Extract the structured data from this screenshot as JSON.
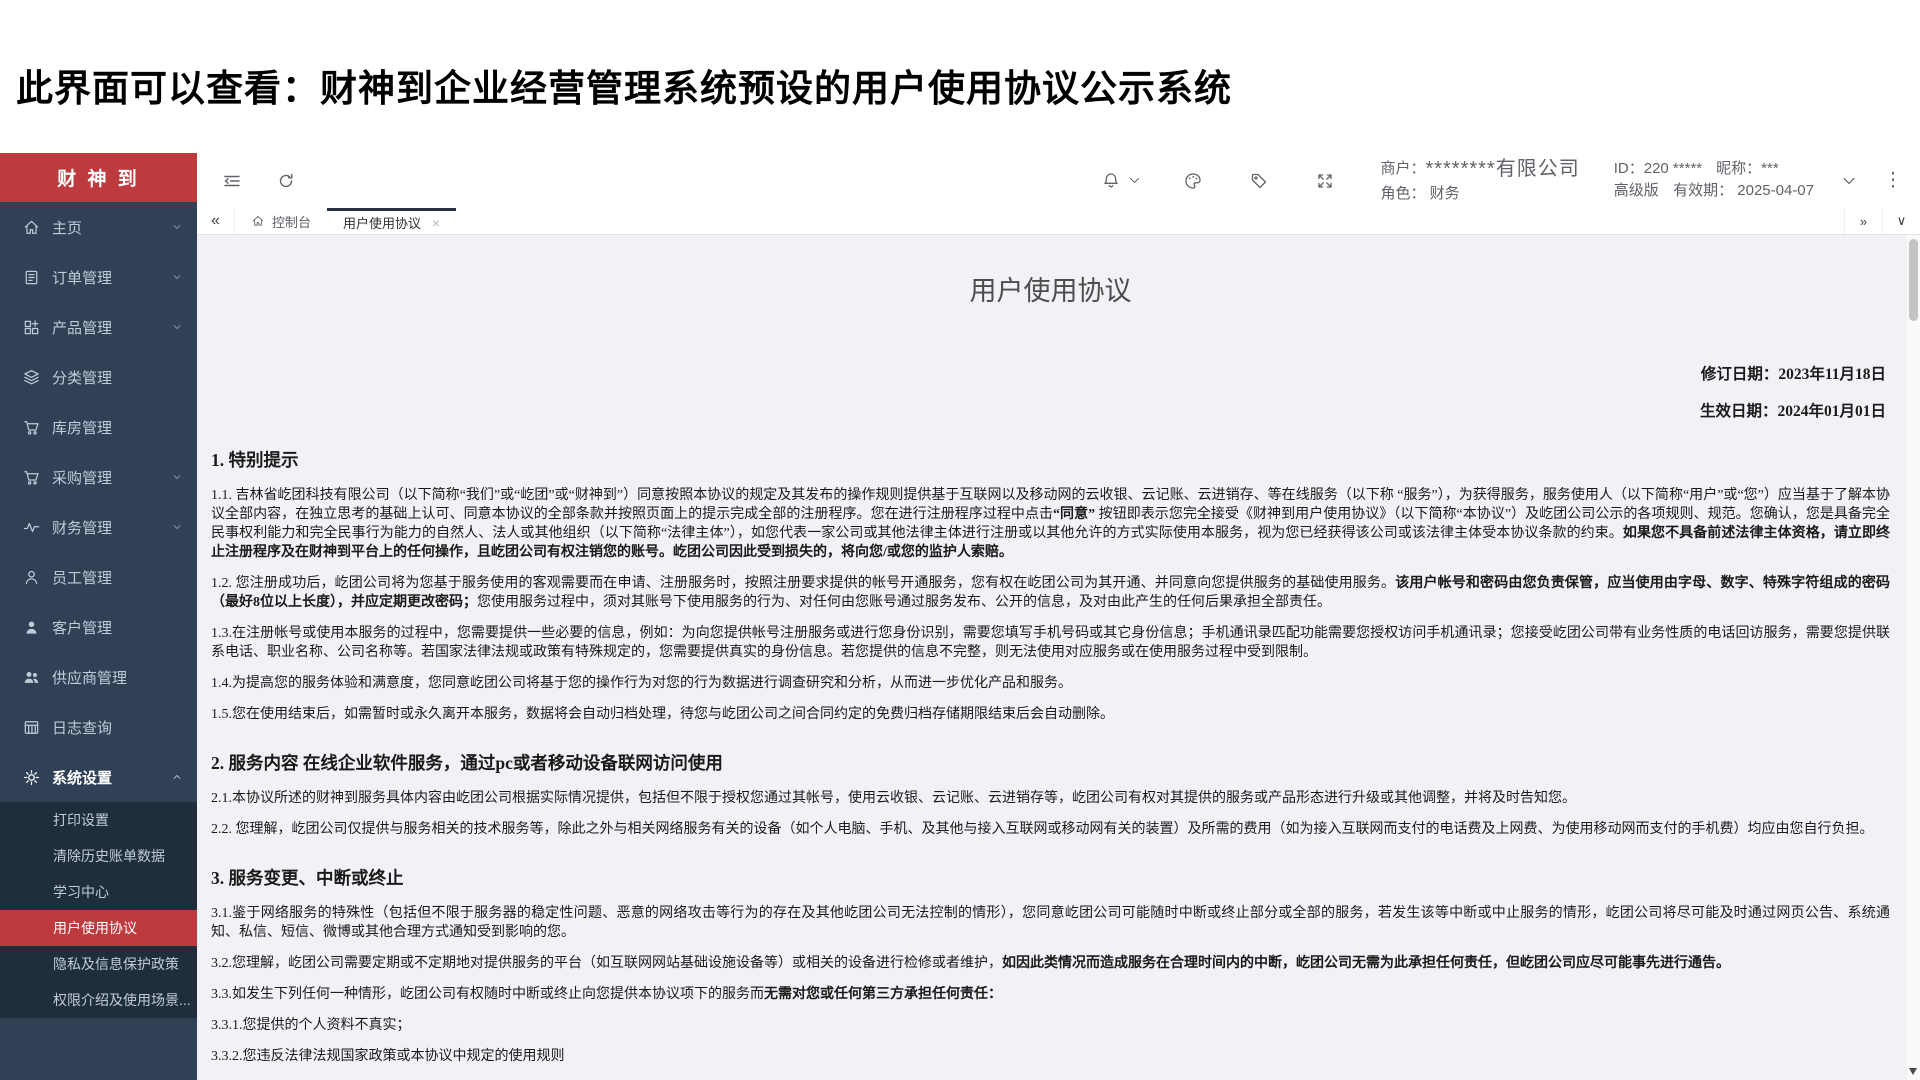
{
  "page": {
    "caption": "此界面可以查看：财神到企业经营管理系统预设的用户使用协议公示系统"
  },
  "sidebar": {
    "brand": "财 神 到",
    "items": [
      {
        "label": "主页",
        "icon": "home-icon",
        "chevron": "down"
      },
      {
        "label": "订单管理",
        "icon": "order-icon",
        "chevron": "down"
      },
      {
        "label": "产品管理",
        "icon": "product-icon",
        "chevron": "down"
      },
      {
        "label": "分类管理",
        "icon": "category-icon",
        "chevron": "none"
      },
      {
        "label": "库房管理",
        "icon": "warehouse-cart-icon",
        "chevron": "none"
      },
      {
        "label": "采购管理",
        "icon": "purchase-cart-icon",
        "chevron": "down"
      },
      {
        "label": "财务管理",
        "icon": "finance-icon",
        "chevron": "down"
      },
      {
        "label": "员工管理",
        "icon": "employee-icon",
        "chevron": "none"
      },
      {
        "label": "客户管理",
        "icon": "customer-icon",
        "chevron": "none"
      },
      {
        "label": "供应商管理",
        "icon": "supplier-icon",
        "chevron": "none"
      },
      {
        "label": "日志查询",
        "icon": "log-icon",
        "chevron": "none"
      },
      {
        "label": "系统设置",
        "icon": "settings-gear-icon",
        "chevron": "up",
        "active": true
      }
    ],
    "submenu": [
      {
        "label": "打印设置",
        "active": false
      },
      {
        "label": "清除历史账单数据",
        "active": false
      },
      {
        "label": "学习中心",
        "active": false
      },
      {
        "label": "用户使用协议",
        "active": true
      },
      {
        "label": "隐私及信息保护政策",
        "active": false
      },
      {
        "label": "权限介绍及使用场景...",
        "active": false
      }
    ]
  },
  "topbar": {
    "merchant_label": "商户：",
    "merchant_value": "********有限公司",
    "role_label": "角色：",
    "role_value": "财务",
    "id_label": "ID：",
    "id_value": "220 *****",
    "nick_label": "昵称：",
    "nick_value": "***",
    "edition": "高级版",
    "validity_label": "有效期：",
    "validity_value": "2025-04-07",
    "more_glyph": "⋮"
  },
  "tabbar": {
    "collapse_left": "«",
    "collapse_right": "»",
    "dropdown": "∨",
    "close_glyph": "×",
    "tabs": [
      {
        "label": "控制台",
        "icon": "home",
        "active": false,
        "closable": false
      },
      {
        "label": "用户使用协议",
        "icon": "",
        "active": true,
        "closable": true
      }
    ]
  },
  "document": {
    "title": "用户使用协议",
    "revision_date": "修订日期：2023年11月18日",
    "effective_date": "生效日期：2024年01月01日",
    "sections": [
      {
        "heading": "1. 特别提示",
        "paragraphs": [
          {
            "runs": [
              {
                "t": "1.1.  吉林省屹团科技有限公司（以下简称“我们”或“屹团”或“财神到”）同意按照本协议的规定及其发布的操作规则提供基于互联网以及移动网的云收银、云记账、云进销存、等在线服务（以下称 “服务”），为获得服务，服务使用人（以下简称“用户”或“您”）应当基于了解本协议全部内容，在独立思考的基础上认可、同意本协议的全部条款并按照页面上的提示完成全部的注册程序。您在进行注册程序过程中点击",
                "b": false
              },
              {
                "t": "“同意” ",
                "b": true
              },
              {
                "t": "按钮即表示您完全接受《财神到用户使用协议》（以下简称“本协议”）及屹团公司公示的各项规则、规范。您确认，您是具备完全民事权利能力和完全民事行为能力的自然人、法人或其他组织（以下简称“法律主体”），如您代表一家公司或其他法律主体进行注册或以其他允许的方式实际使用本服务，视为您已经获得该公司或该法律主体受本协议条款的约束。",
                "b": false
              },
              {
                "t": "如果您不具备前述法律主体资格，请立即终止注册程序及在财神到平台上的任何操作，且屹团公司有权注销您的账号。屹团公司因此受到损失的，将向您/或您的监护人索赔。",
                "b": true
              }
            ]
          },
          {
            "runs": [
              {
                "t": "1.2.  您注册成功后，屹团公司将为您基于服务使用的客观需要而在申请、注册服务时，按照注册要求提供的帐号开通服务，您有权在屹团公司为其开通、并同意向您提供服务的基础使用服务。",
                "b": false
              },
              {
                "t": "该用户帐号和密码由您负责保管，应当使用由字母、数字、特殊字符组成的密码（最好8位以上长度），并应定期更改密码；",
                "b": true
              },
              {
                "t": "您使用服务过程中，须对其账号下使用服务的行为、对任何由您账号通过服务发布、公开的信息，及对由此产生的任何后果承担全部责任。",
                "b": false
              }
            ]
          },
          {
            "runs": [
              {
                "t": "1.3.在注册帐号或使用本服务的过程中，您需要提供一些必要的信息，例如：为向您提供帐号注册服务或进行您身份识别，需要您填写手机号码或其它身份信息；手机通讯录匹配功能需要您授权访问手机通讯录；您接受屹团公司带有业务性质的电话回访服务，需要您提供联系电话、职业名称、公司名称等。若国家法律法规或政策有特殊规定的，您需要提供真实的身份信息。若您提供的信息不完整，则无法使用对应服务或在使用服务过程中受到限制。",
                "b": false
              }
            ]
          },
          {
            "runs": [
              {
                "t": "1.4.为提高您的服务体验和满意度，您同意屹团公司将基于您的操作行为对您的行为数据进行调查研究和分析，从而进一步优化产品和服务。",
                "b": false
              }
            ]
          },
          {
            "runs": [
              {
                "t": "1.5.您在使用结束后，如需暂时或永久离开本服务，数据将会自动归档处理，待您与屹团公司之间合同约定的免费归档存储期限结束后会自动删除。",
                "b": false
              }
            ]
          }
        ]
      },
      {
        "heading": "2. 服务内容  在线企业软件服务，通过pc或者移动设备联网访问使用",
        "paragraphs": [
          {
            "runs": [
              {
                "t": "2.1.本协议所述的财神到服务具体内容由屹团公司根据实际情况提供，包括但不限于授权您通过其帐号，使用云收银、云记账、云进销存等，屹团公司有权对其提供的服务或产品形态进行升级或其他调整，并将及时告知您。",
                "b": false
              }
            ]
          },
          {
            "runs": [
              {
                "t": "2.2.  您理解，屹团公司仅提供与服务相关的技术服务等，除此之外与相关网络服务有关的设备（如个人电脑、手机、及其他与接入互联网或移动网有关的装置）及所需的费用（如为接入互联网而支付的电话费及上网费、为使用移动网而支付的手机费）均应由您自行负担。",
                "b": false
              }
            ]
          }
        ]
      },
      {
        "heading": "3. 服务变更、中断或终止",
        "paragraphs": [
          {
            "runs": [
              {
                "t": "3.1.鉴于网络服务的特殊性（包括但不限于服务器的稳定性问题、恶意的网络攻击等行为的存在及其他屹团公司无法控制的情形），您同意屹团公司可能随时中断或终止部分或全部的服务，若发生该等中断或中止服务的情形，屹团公司将尽可能及时通过网页公告、系统通知、私信、短信、微博或其他合理方式通知受到影响的您。",
                "b": false
              }
            ]
          },
          {
            "runs": [
              {
                "t": "3.2.您理解，屹团公司需要定期或不定期地对提供服务的平台（如互联网网站基础设施设备等）或相关的设备进行检修或者维护，",
                "b": false
              },
              {
                "t": "如因此类情况而造成服务在合理时间内的中断，屹团公司无需为此承担任何责任，但屹团公司应尽可能事先进行通告。",
                "b": true
              }
            ]
          },
          {
            "runs": [
              {
                "t": "3.3.如发生下列任何一种情形，屹团公司有权随时中断或终止向您提供本协议项下的服务而",
                "b": false
              },
              {
                "t": "无需对您或任何第三方承担任何责任：",
                "b": true
              }
            ]
          },
          {
            "runs": [
              {
                "t": "3.3.1.您提供的个人资料不真实；",
                "b": false
              }
            ]
          },
          {
            "runs": [
              {
                "t": "3.3.2.您违反法律法规国家政策或本协议中规定的使用规则",
                "b": false
              }
            ]
          }
        ]
      }
    ]
  }
}
